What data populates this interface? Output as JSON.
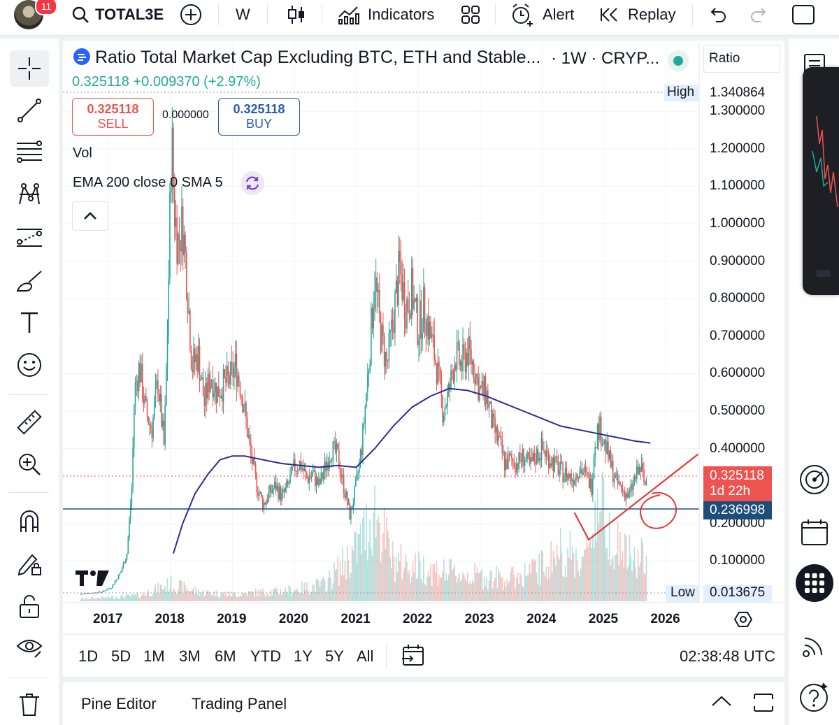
{
  "topbar": {
    "notification_count": "11",
    "symbol": "TOTAL3E",
    "interval": "W",
    "indicators_label": "Indicators",
    "alert_label": "Alert",
    "replay_label": "Replay"
  },
  "legend": {
    "title": "Ratio Total Market Cap Excluding BTC, ETH and Stable...",
    "subtitle": "· 1W · CRYP...",
    "last_price": "0.325118",
    "change": "+0.009370 (+2.97%)",
    "sell_price": "0.325118",
    "sell_label": "SELL",
    "spread": "0.000000",
    "buy_price": "0.325118",
    "buy_label": "BUY",
    "vol_label": "Vol",
    "indicator_label": "EMA 200 close 0 SMA 5",
    "scale_mode": "Ratio"
  },
  "colors": {
    "up": "#26a69a",
    "down": "#ef5350",
    "ema": "#2b2d8f",
    "accent": "#2962ff",
    "annotation": "#e53935"
  },
  "chart_data": {
    "type": "candlestick",
    "timeframe": "1W",
    "ylim": [
      0.0,
      1.36
    ],
    "y_ticks": [
      "1.300000",
      "1.200000",
      "1.100000",
      "1.000000",
      "0.900000",
      "0.800000",
      "0.700000",
      "0.600000",
      "0.500000",
      "0.400000",
      "0.200000",
      "0.100000"
    ],
    "x_ticks": [
      "2017",
      "2018",
      "2019",
      "2020",
      "2021",
      "2022",
      "2023",
      "2024",
      "2025",
      "2026"
    ],
    "high_label": "High",
    "high": "1.340864",
    "low_label": "Low",
    "low": "0.013675",
    "last_value": "0.325118",
    "countdown": "1d 22h",
    "horizontal_line": "0.236998",
    "close_path": [
      [
        2016.55,
        0.012
      ],
      [
        2016.9,
        0.018
      ],
      [
        2017.05,
        0.03
      ],
      [
        2017.2,
        0.07
      ],
      [
        2017.3,
        0.12
      ],
      [
        2017.38,
        0.3
      ],
      [
        2017.42,
        0.55
      ],
      [
        2017.5,
        0.62
      ],
      [
        2017.6,
        0.5
      ],
      [
        2017.7,
        0.45
      ],
      [
        2017.8,
        0.58
      ],
      [
        2017.9,
        0.4
      ],
      [
        2017.96,
        0.75
      ],
      [
        2018.02,
        1.25
      ],
      [
        2018.06,
        1.05
      ],
      [
        2018.12,
        0.95
      ],
      [
        2018.2,
        1.0
      ],
      [
        2018.27,
        0.85
      ],
      [
        2018.35,
        0.62
      ],
      [
        2018.45,
        0.65
      ],
      [
        2018.55,
        0.52
      ],
      [
        2018.65,
        0.6
      ],
      [
        2018.75,
        0.55
      ],
      [
        2018.85,
        0.57
      ],
      [
        2018.95,
        0.58
      ],
      [
        2019.05,
        0.62
      ],
      [
        2019.12,
        0.58
      ],
      [
        2019.2,
        0.5
      ],
      [
        2019.3,
        0.38
      ],
      [
        2019.4,
        0.3
      ],
      [
        2019.5,
        0.25
      ],
      [
        2019.6,
        0.28
      ],
      [
        2019.7,
        0.3
      ],
      [
        2019.8,
        0.27
      ],
      [
        2019.9,
        0.3
      ],
      [
        2020.0,
        0.35
      ],
      [
        2020.1,
        0.36
      ],
      [
        2020.2,
        0.32
      ],
      [
        2020.3,
        0.33
      ],
      [
        2020.4,
        0.3
      ],
      [
        2020.5,
        0.35
      ],
      [
        2020.6,
        0.4
      ],
      [
        2020.7,
        0.38
      ],
      [
        2020.8,
        0.3
      ],
      [
        2020.9,
        0.22
      ],
      [
        2021.0,
        0.3
      ],
      [
        2021.1,
        0.42
      ],
      [
        2021.2,
        0.62
      ],
      [
        2021.3,
        0.86
      ],
      [
        2021.4,
        0.7
      ],
      [
        2021.5,
        0.62
      ],
      [
        2021.6,
        0.75
      ],
      [
        2021.7,
        0.88
      ],
      [
        2021.8,
        0.78
      ],
      [
        2021.9,
        0.82
      ],
      [
        2022.0,
        0.72
      ],
      [
        2022.1,
        0.78
      ],
      [
        2022.2,
        0.7
      ],
      [
        2022.3,
        0.62
      ],
      [
        2022.4,
        0.5
      ],
      [
        2022.5,
        0.55
      ],
      [
        2022.6,
        0.65
      ],
      [
        2022.7,
        0.62
      ],
      [
        2022.8,
        0.66
      ],
      [
        2022.9,
        0.62
      ],
      [
        2023.0,
        0.55
      ],
      [
        2023.1,
        0.55
      ],
      [
        2023.2,
        0.46
      ],
      [
        2023.3,
        0.42
      ],
      [
        2023.4,
        0.36
      ],
      [
        2023.5,
        0.37
      ],
      [
        2023.6,
        0.36
      ],
      [
        2023.7,
        0.38
      ],
      [
        2023.8,
        0.35
      ],
      [
        2023.9,
        0.38
      ],
      [
        2024.0,
        0.4
      ],
      [
        2024.1,
        0.38
      ],
      [
        2024.2,
        0.36
      ],
      [
        2024.3,
        0.34
      ],
      [
        2024.4,
        0.33
      ],
      [
        2024.5,
        0.32
      ],
      [
        2024.6,
        0.35
      ],
      [
        2024.7,
        0.33
      ],
      [
        2024.8,
        0.3
      ],
      [
        2024.85,
        0.42
      ],
      [
        2024.92,
        0.46
      ],
      [
        2025.0,
        0.42
      ],
      [
        2025.1,
        0.36
      ],
      [
        2025.2,
        0.31
      ],
      [
        2025.3,
        0.29
      ],
      [
        2025.4,
        0.27
      ],
      [
        2025.5,
        0.32
      ],
      [
        2025.6,
        0.35
      ],
      [
        2025.66,
        0.3
      ],
      [
        2025.7,
        0.325
      ]
    ],
    "ema_path": [
      [
        2018.05,
        0.12
      ],
      [
        2018.2,
        0.2
      ],
      [
        2018.4,
        0.28
      ],
      [
        2018.6,
        0.33
      ],
      [
        2018.8,
        0.37
      ],
      [
        2019.0,
        0.38
      ],
      [
        2019.2,
        0.38
      ],
      [
        2019.5,
        0.37
      ],
      [
        2019.8,
        0.36
      ],
      [
        2020.1,
        0.355
      ],
      [
        2020.4,
        0.35
      ],
      [
        2020.7,
        0.355
      ],
      [
        2021.0,
        0.35
      ],
      [
        2021.3,
        0.4
      ],
      [
        2021.6,
        0.46
      ],
      [
        2021.9,
        0.51
      ],
      [
        2022.2,
        0.54
      ],
      [
        2022.5,
        0.56
      ],
      [
        2022.8,
        0.555
      ],
      [
        2023.1,
        0.54
      ],
      [
        2023.4,
        0.52
      ],
      [
        2023.7,
        0.5
      ],
      [
        2024.0,
        0.48
      ],
      [
        2024.3,
        0.46
      ],
      [
        2024.6,
        0.45
      ],
      [
        2024.9,
        0.44
      ],
      [
        2025.2,
        0.43
      ],
      [
        2025.5,
        0.42
      ],
      [
        2025.75,
        0.415
      ]
    ],
    "volume_path": [
      [
        2016.55,
        0.02
      ],
      [
        2017.5,
        0.05
      ],
      [
        2018.0,
        0.15
      ],
      [
        2018.5,
        0.08
      ],
      [
        2019.0,
        0.06
      ],
      [
        2019.5,
        0.08
      ],
      [
        2020.0,
        0.1
      ],
      [
        2020.5,
        0.15
      ],
      [
        2021.0,
        0.45
      ],
      [
        2021.3,
        0.8
      ],
      [
        2021.6,
        0.35
      ],
      [
        2022.0,
        0.3
      ],
      [
        2022.5,
        0.25
      ],
      [
        2023.0,
        0.22
      ],
      [
        2023.5,
        0.2
      ],
      [
        2024.0,
        0.3
      ],
      [
        2024.3,
        0.45
      ],
      [
        2024.7,
        0.35
      ],
      [
        2024.9,
        0.9
      ],
      [
        2025.2,
        0.5
      ],
      [
        2025.5,
        0.35
      ],
      [
        2025.7,
        0.4
      ]
    ]
  },
  "timeframes": [
    "1D",
    "5D",
    "1M",
    "3M",
    "6M",
    "YTD",
    "1Y",
    "5Y",
    "All"
  ],
  "clock": "02:38:48 UTC",
  "bottom": {
    "pine_editor": "Pine Editor",
    "trading_panel": "Trading Panel"
  }
}
